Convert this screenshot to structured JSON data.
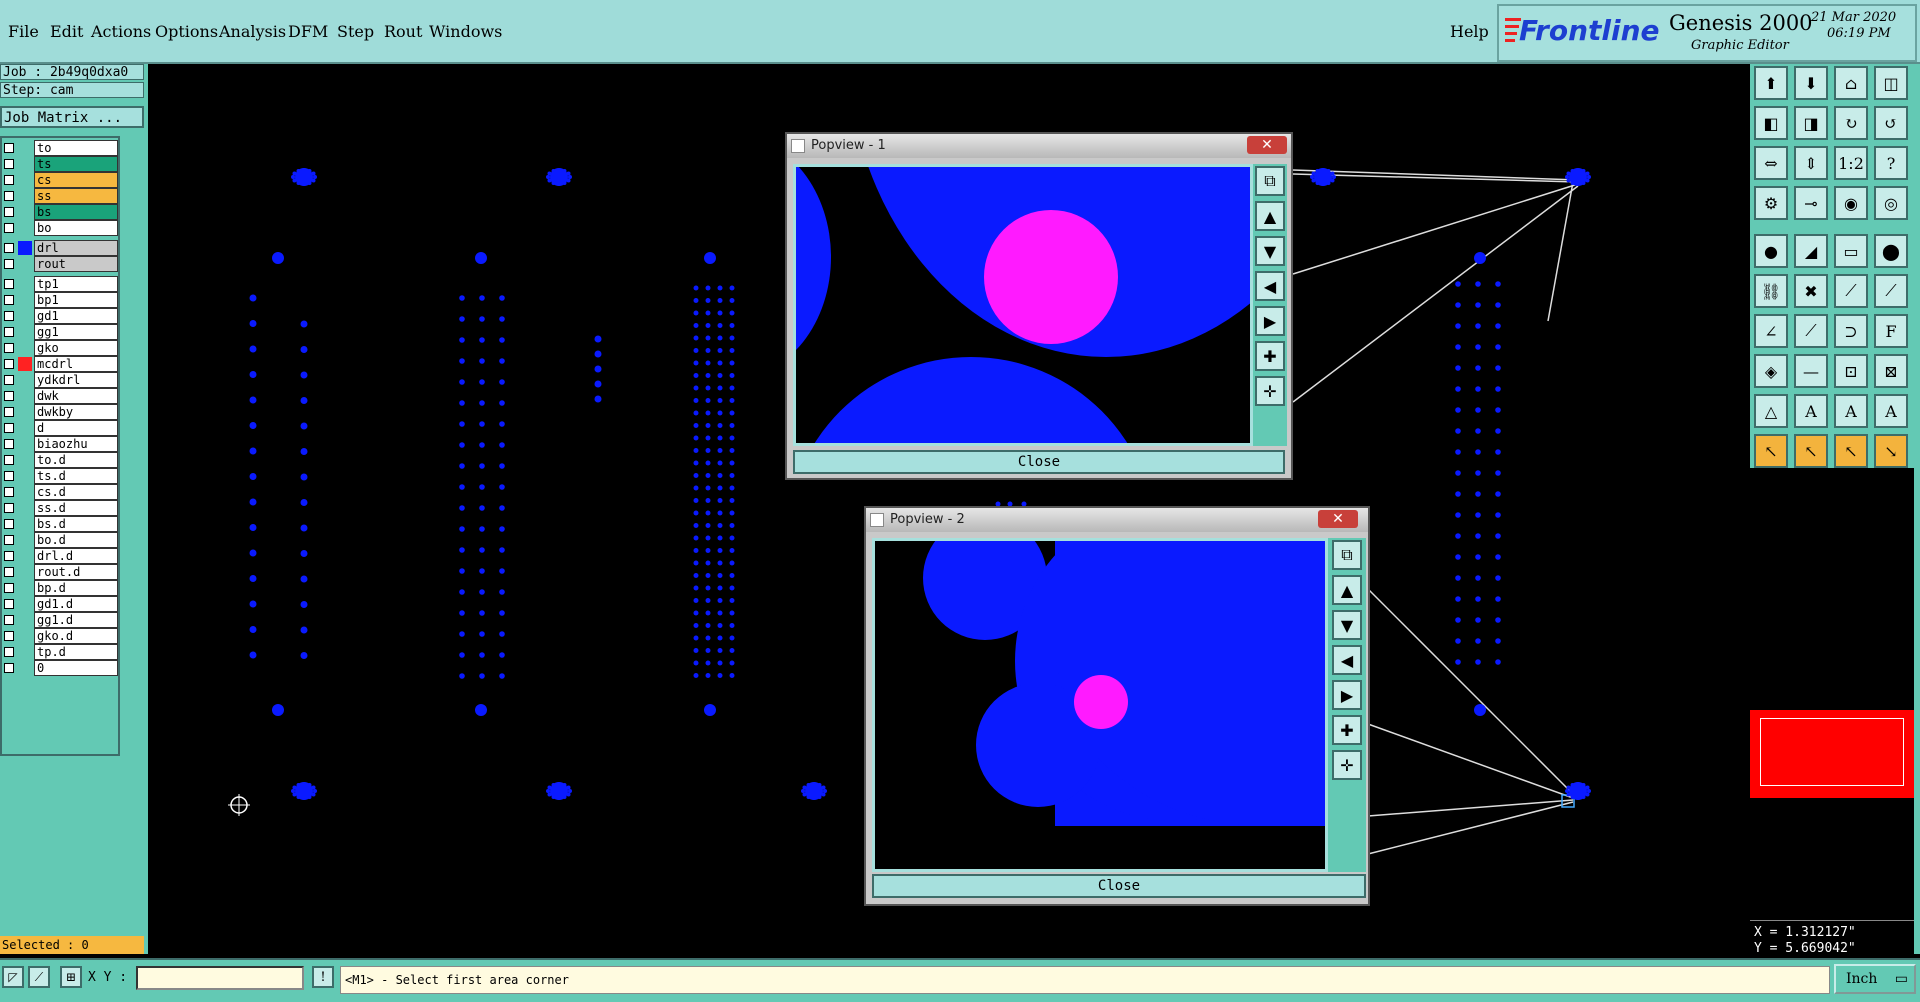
{
  "menu": {
    "items": [
      "File",
      "Edit",
      "Actions",
      "Options",
      "Analysis",
      "DFM",
      "Step",
      "Rout",
      "Windows"
    ],
    "help": "Help"
  },
  "brand": {
    "logo": "Frontline",
    "product": "Genesis 2000",
    "subtitle": "Graphic Editor",
    "date": "21 Mar 2020",
    "time": "06:19 PM"
  },
  "left": {
    "job": "Job : 2b49q0dxa0",
    "step": "Step: cam",
    "job_matrix": "Job Matrix ...",
    "selected": "Selected : 0",
    "layers": [
      {
        "name": "to",
        "color": "#ffffff"
      },
      {
        "name": "ts",
        "color": "#1aa37a"
      },
      {
        "name": "cs",
        "color": "#f6b840"
      },
      {
        "name": "ss",
        "color": "#f6b840"
      },
      {
        "name": "bs",
        "color": "#1aa37a"
      },
      {
        "name": "bo",
        "color": "#ffffff"
      },
      {
        "name": "drl",
        "color": "#c9c9c9",
        "swatch": "#0a1aff"
      },
      {
        "name": "rout",
        "color": "#c9c9c9"
      },
      {
        "name": "tp1",
        "color": "#ffffff"
      },
      {
        "name": "bp1",
        "color": "#ffffff"
      },
      {
        "name": "gd1",
        "color": "#ffffff"
      },
      {
        "name": "gg1",
        "color": "#ffffff"
      },
      {
        "name": "gko",
        "color": "#ffffff"
      },
      {
        "name": "mcdrl",
        "color": "#ffffff",
        "swatch": "#ff2222"
      },
      {
        "name": "ydkdrl",
        "color": "#ffffff"
      },
      {
        "name": "dwk",
        "color": "#ffffff"
      },
      {
        "name": "dwkby",
        "color": "#ffffff"
      },
      {
        "name": "d",
        "color": "#ffffff"
      },
      {
        "name": "biaozhu",
        "color": "#ffffff"
      },
      {
        "name": "to.d",
        "color": "#ffffff"
      },
      {
        "name": "ts.d",
        "color": "#ffffff"
      },
      {
        "name": "cs.d",
        "color": "#ffffff"
      },
      {
        "name": "ss.d",
        "color": "#ffffff"
      },
      {
        "name": "bs.d",
        "color": "#ffffff"
      },
      {
        "name": "bo.d",
        "color": "#ffffff"
      },
      {
        "name": "drl.d",
        "color": "#ffffff"
      },
      {
        "name": "rout.d",
        "color": "#ffffff"
      },
      {
        "name": "bp.d",
        "color": "#ffffff"
      },
      {
        "name": "gd1.d",
        "color": "#ffffff"
      },
      {
        "name": "gg1.d",
        "color": "#ffffff"
      },
      {
        "name": "gko.d",
        "color": "#ffffff"
      },
      {
        "name": "tp.d",
        "color": "#ffffff"
      },
      {
        "name": "0",
        "color": "#ffffff"
      }
    ]
  },
  "popview1": {
    "title": "Popview - 1",
    "close_label": "Close",
    "close_x": "✕"
  },
  "popview2": {
    "title": "Popview - 2",
    "close_label": "Close",
    "close_x": "✕"
  },
  "coords": {
    "x": "X = 1.312127\"",
    "y": "Y = 5.669042\""
  },
  "bottom": {
    "xy_label": "X Y :",
    "xy_value": "",
    "status": "<M1> - Select first area corner",
    "units": "Inch"
  },
  "colors": {
    "teal": "#63c9b4",
    "light_teal": "#a6e0dd",
    "pad_blue": "#0a1aff",
    "highlight_magenta": "#ff1aff",
    "preview_red": "#ff0000"
  }
}
